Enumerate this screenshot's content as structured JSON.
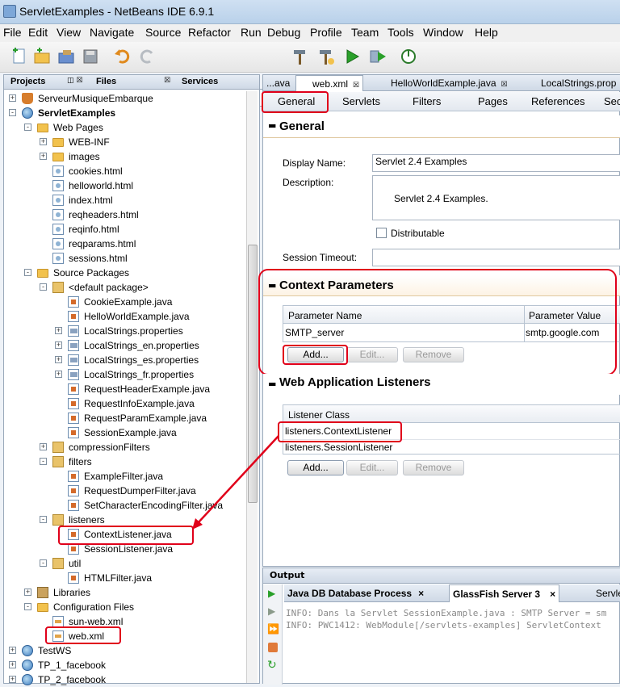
{
  "window": {
    "title": "ServletExamples - NetBeans IDE 6.9.1"
  },
  "menu": [
    "File",
    "Edit",
    "View",
    "Navigate",
    "Source",
    "Refactor",
    "Run",
    "Debug",
    "Profile",
    "Team",
    "Tools",
    "Window",
    "Help"
  ],
  "toolbar": {
    "config_value": ""
  },
  "left_panel": {
    "tabs": [
      "Projects",
      "Files",
      "Services"
    ],
    "tree": [
      {
        "label": "ServeurMusiqueEmbarque",
        "level": 0,
        "icon": "coffee-cup-icon",
        "toggle": "+"
      },
      {
        "label": "ServletExamples",
        "level": 0,
        "icon": "globe-icon",
        "toggle": "-",
        "bold": true
      },
      {
        "label": "Web Pages",
        "level": 1,
        "icon": "folder-icon",
        "toggle": "-"
      },
      {
        "label": "WEB-INF",
        "level": 2,
        "icon": "folder-icon",
        "toggle": "+"
      },
      {
        "label": "images",
        "level": 2,
        "icon": "folder-icon",
        "toggle": "+"
      },
      {
        "label": "cookies.html",
        "level": 2,
        "icon": "html-file-icon"
      },
      {
        "label": "helloworld.html",
        "level": 2,
        "icon": "html-file-icon"
      },
      {
        "label": "index.html",
        "level": 2,
        "icon": "html-file-icon"
      },
      {
        "label": "reqheaders.html",
        "level": 2,
        "icon": "html-file-icon"
      },
      {
        "label": "reqinfo.html",
        "level": 2,
        "icon": "html-file-icon"
      },
      {
        "label": "reqparams.html",
        "level": 2,
        "icon": "html-file-icon"
      },
      {
        "label": "sessions.html",
        "level": 2,
        "icon": "html-file-icon"
      },
      {
        "label": "Source Packages",
        "level": 1,
        "icon": "folder-icon",
        "toggle": "-"
      },
      {
        "label": "<default package>",
        "level": 2,
        "icon": "package-icon",
        "toggle": "-"
      },
      {
        "label": "CookieExample.java",
        "level": 3,
        "icon": "java-file-icon"
      },
      {
        "label": "HelloWorldExample.java",
        "level": 3,
        "icon": "java-file-icon"
      },
      {
        "label": "LocalStrings.properties",
        "level": 3,
        "icon": "properties-file-icon",
        "toggle": "+"
      },
      {
        "label": "LocalStrings_en.properties",
        "level": 3,
        "icon": "properties-file-icon",
        "toggle": "+"
      },
      {
        "label": "LocalStrings_es.properties",
        "level": 3,
        "icon": "properties-file-icon",
        "toggle": "+"
      },
      {
        "label": "LocalStrings_fr.properties",
        "level": 3,
        "icon": "properties-file-icon",
        "toggle": "+"
      },
      {
        "label": "RequestHeaderExample.java",
        "level": 3,
        "icon": "java-file-icon"
      },
      {
        "label": "RequestInfoExample.java",
        "level": 3,
        "icon": "java-file-icon"
      },
      {
        "label": "RequestParamExample.java",
        "level": 3,
        "icon": "java-file-icon"
      },
      {
        "label": "SessionExample.java",
        "level": 3,
        "icon": "java-file-icon"
      },
      {
        "label": "compressionFilters",
        "level": 2,
        "icon": "package-icon",
        "toggle": "+"
      },
      {
        "label": "filters",
        "level": 2,
        "icon": "package-icon",
        "toggle": "-"
      },
      {
        "label": "ExampleFilter.java",
        "level": 3,
        "icon": "java-file-icon"
      },
      {
        "label": "RequestDumperFilter.java",
        "level": 3,
        "icon": "java-file-icon"
      },
      {
        "label": "SetCharacterEncodingFilter.java",
        "level": 3,
        "icon": "java-file-icon"
      },
      {
        "label": "listeners",
        "level": 2,
        "icon": "package-icon",
        "toggle": "-"
      },
      {
        "label": "ContextListener.java",
        "level": 3,
        "icon": "java-file-icon",
        "highlight": true
      },
      {
        "label": "SessionListener.java",
        "level": 3,
        "icon": "java-file-icon"
      },
      {
        "label": "util",
        "level": 2,
        "icon": "package-icon",
        "toggle": "-"
      },
      {
        "label": "HTMLFilter.java",
        "level": 3,
        "icon": "java-file-icon"
      },
      {
        "label": "Libraries",
        "level": 1,
        "icon": "library-icon",
        "toggle": "+"
      },
      {
        "label": "Configuration Files",
        "level": 1,
        "icon": "folder-icon",
        "toggle": "-"
      },
      {
        "label": "sun-web.xml",
        "level": 2,
        "icon": "xml-file-icon"
      },
      {
        "label": "web.xml",
        "level": 2,
        "icon": "xml-file-icon",
        "highlight": true
      },
      {
        "label": "TestWS",
        "level": 0,
        "icon": "globe-icon",
        "toggle": "+"
      },
      {
        "label": "TP_1_facebook",
        "level": 0,
        "icon": "globe-icon",
        "toggle": "+"
      },
      {
        "label": "TP_2_facebook",
        "level": 0,
        "icon": "globe-icon",
        "toggle": "+"
      }
    ]
  },
  "editor": {
    "tabs": [
      "...ava",
      "web.xml",
      "HelloWorldExample.java",
      "LocalStrings.prop"
    ],
    "subtabs": [
      "General",
      "Servlets",
      "Filters",
      "Pages",
      "References",
      "Sec"
    ],
    "general": {
      "header": "General",
      "display_name_label": "Display Name:",
      "display_name_value": "Servlet 2.4 Examples",
      "description_label": "Description:",
      "description_value": "Servlet 2.4 Examples.",
      "distributable_label": "Distributable",
      "session_timeout_label": "Session Timeout:",
      "session_timeout_value": ""
    },
    "context_params": {
      "header": "Context Parameters",
      "col_name": "Parameter Name",
      "col_value": "Parameter Value",
      "row_name": "SMTP_server",
      "row_value": "smtp.google.com",
      "add": "Add...",
      "edit": "Edit...",
      "remove": "Remove"
    },
    "listeners": {
      "header": "Web Application Listeners",
      "col": "Listener Class",
      "row1": "listeners.ContextListener",
      "row2": "listeners.SessionListener",
      "add": "Add...",
      "edit": "Edit...",
      "remove": "Remove"
    }
  },
  "output": {
    "title": "Output",
    "tabs": [
      "Java DB Database Process",
      "GlassFish Server 3",
      "ServletEx"
    ],
    "lines": [
      "INFO: Dans la Servlet SessionExample.java : SMTP Server = sm",
      "INFO: PWC1412: WebModule[/servlets-examples] ServletContext"
    ]
  }
}
